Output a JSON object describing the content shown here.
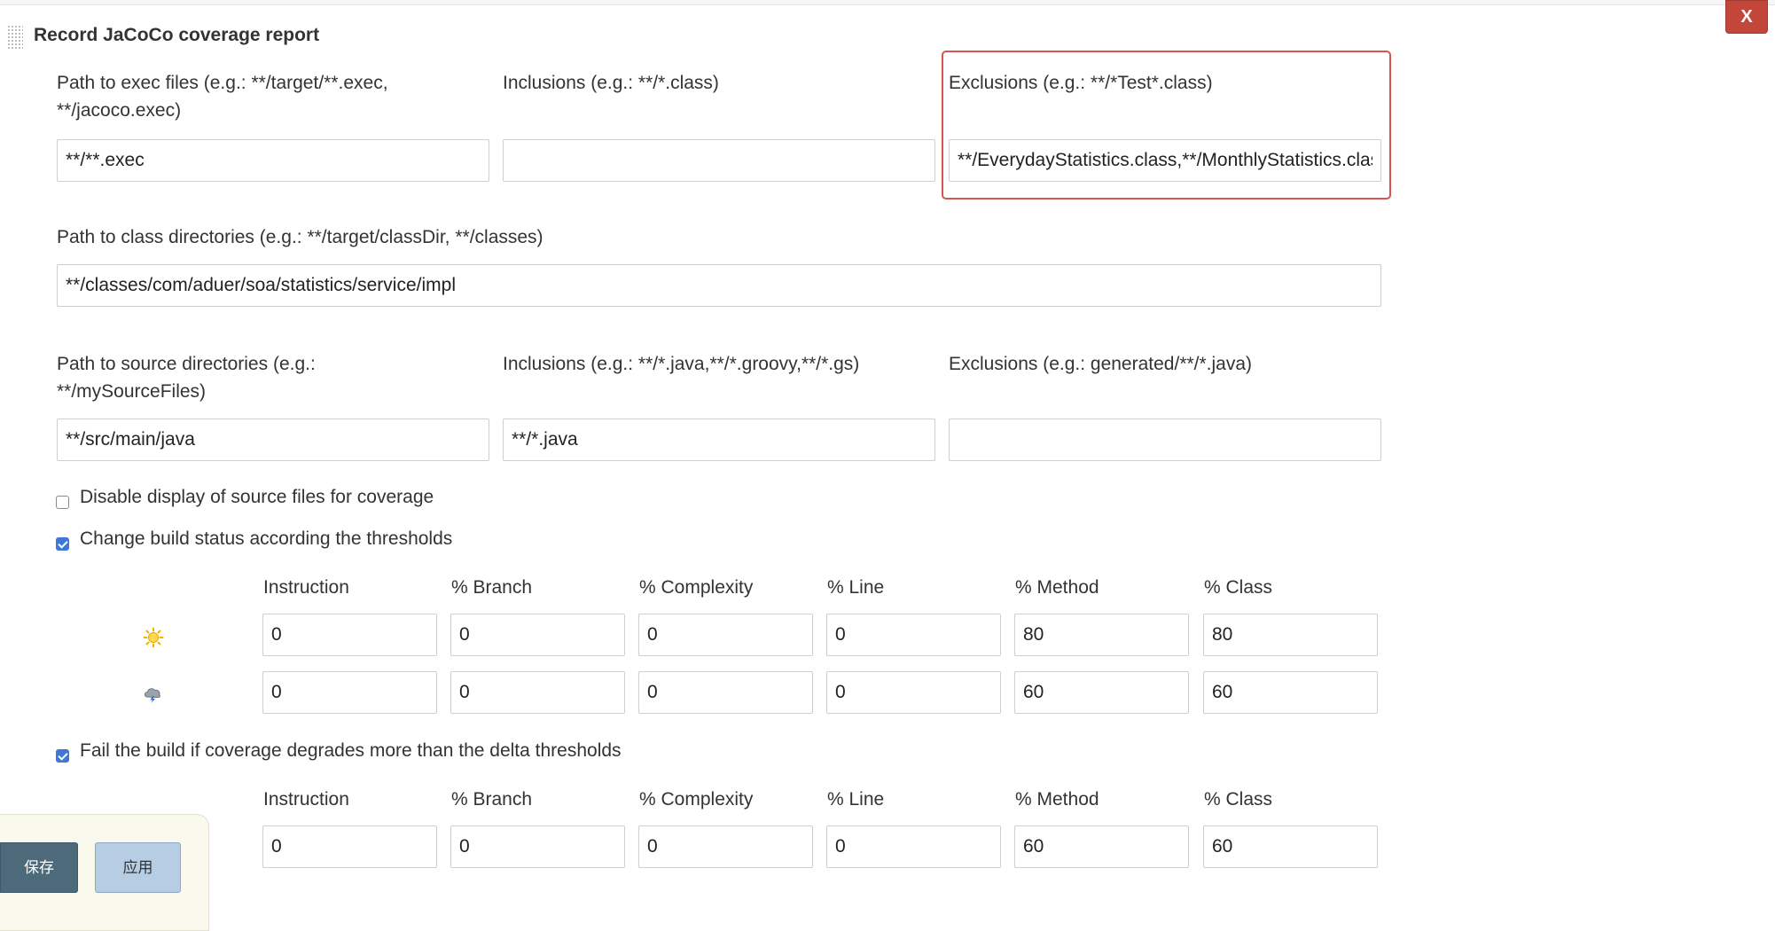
{
  "section": {
    "title": "Record JaCoCo coverage report",
    "close_label": "X"
  },
  "exec": {
    "path_label": "Path to exec files (e.g.: **/target/**.exec, **/jacoco.exec)",
    "path_value": "**/**.exec",
    "inclusions_label": "Inclusions (e.g.: **/*.class)",
    "inclusions_value": "",
    "exclusions_label": "Exclusions (e.g.: **/*Test*.class)",
    "exclusions_value": "**/EverydayStatistics.class,**/MonthlyStatistics.class"
  },
  "classes": {
    "label": "Path to class directories (e.g.: **/target/classDir, **/classes)",
    "value": "**/classes/com/aduer/soa/statistics/service/impl"
  },
  "sources": {
    "path_label": "Path to source directories (e.g.: **/mySourceFiles)",
    "path_value": "**/src/main/java",
    "inclusions_label": "Inclusions (e.g.: **/*.java,**/*.groovy,**/*.gs)",
    "inclusions_value": "**/*.java",
    "exclusions_label": "Exclusions (e.g.: generated/**/*.java)",
    "exclusions_value": ""
  },
  "options": {
    "disable_source": {
      "label": "Disable display of source files for coverage",
      "checked": false
    },
    "change_status": {
      "label": "Change build status according the thresholds",
      "checked": true
    },
    "fail_delta": {
      "label": "Fail the build if coverage degrades more than the delta thresholds",
      "checked": true
    }
  },
  "thresholds": {
    "headers": [
      "Instruction",
      "% Branch",
      "% Complexity",
      "% Line",
      "% Method",
      "% Class"
    ],
    "rows": [
      {
        "icon": "sunny-icon",
        "values": [
          "0",
          "0",
          "0",
          "0",
          "80",
          "80"
        ]
      },
      {
        "icon": "storm-icon",
        "values": [
          "0",
          "0",
          "0",
          "0",
          "60",
          "60"
        ]
      }
    ]
  },
  "delta": {
    "headers": [
      "Instruction",
      "% Branch",
      "% Complexity",
      "% Line",
      "% Method",
      "% Class"
    ],
    "values": [
      "0",
      "0",
      "0",
      "0",
      "60",
      "60"
    ]
  },
  "footer": {
    "save_label": "保存",
    "apply_label": "应用"
  },
  "colors": {
    "close_bg": "#c2463a",
    "highlight_border": "#d9534f",
    "checkbox_checked": "#3f78d8",
    "save_bg": "#4d6a7a",
    "apply_bg": "#b6cde3"
  }
}
